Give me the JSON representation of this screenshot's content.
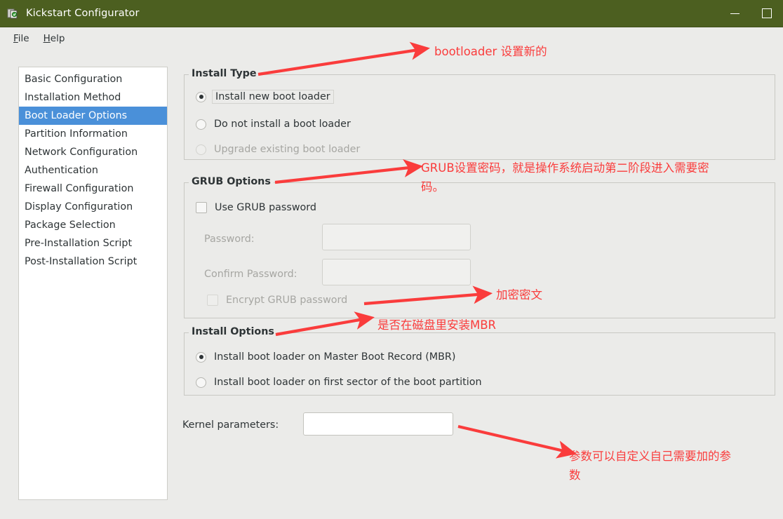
{
  "window": {
    "title": "Kickstart Configurator",
    "icon": "app-icon",
    "minimize_label": "Minimize",
    "maximize_label": "Maximize"
  },
  "menubar": {
    "items": [
      {
        "label": "File",
        "mnemonic": "F"
      },
      {
        "label": "Help",
        "mnemonic": "H"
      }
    ]
  },
  "sidebar": {
    "items": [
      {
        "label": "Basic Configuration",
        "selected": false
      },
      {
        "label": "Installation Method",
        "selected": false
      },
      {
        "label": "Boot Loader Options",
        "selected": true
      },
      {
        "label": "Partition Information",
        "selected": false
      },
      {
        "label": "Network Configuration",
        "selected": false
      },
      {
        "label": "Authentication",
        "selected": false
      },
      {
        "label": "Firewall Configuration",
        "selected": false
      },
      {
        "label": "Display Configuration",
        "selected": false
      },
      {
        "label": "Package Selection",
        "selected": false
      },
      {
        "label": "Pre-Installation Script",
        "selected": false
      },
      {
        "label": "Post-Installation Script",
        "selected": false
      }
    ]
  },
  "install_type": {
    "legend": "Install Type",
    "options": [
      {
        "label": "Install new boot loader",
        "checked": true,
        "disabled": false,
        "focused": true
      },
      {
        "label": "Do not install a boot loader",
        "checked": false,
        "disabled": false,
        "focused": false
      },
      {
        "label": "Upgrade existing boot loader",
        "checked": false,
        "disabled": true,
        "focused": false
      }
    ]
  },
  "grub_options": {
    "legend": "GRUB Options",
    "use_grub_password": {
      "label": "Use GRUB password",
      "checked": false,
      "disabled": false
    },
    "password": {
      "label": "Password:",
      "value": "",
      "disabled": true
    },
    "confirm_password": {
      "label": "Confirm Password:",
      "value": "",
      "disabled": true
    },
    "encrypt": {
      "label": "Encrypt GRUB password",
      "checked": false,
      "disabled": true
    }
  },
  "install_options": {
    "legend": "Install Options",
    "options": [
      {
        "label": "Install boot loader on Master Boot Record (MBR)",
        "checked": true
      },
      {
        "label": "Install boot loader on first sector of the boot partition",
        "checked": false
      }
    ]
  },
  "kernel_parameters": {
    "label": "Kernel parameters:",
    "value": "",
    "placeholder": ""
  },
  "annotations": {
    "color": "#fa3c3c",
    "notes": [
      {
        "id": "note-bootloader",
        "text": "bootloader 设置新的"
      },
      {
        "id": "note-grub-password",
        "text": "GRUB设置密码，就是操作系统启动第二阶段进入需要密\n码。"
      },
      {
        "id": "note-encrypt",
        "text": "加密密文"
      },
      {
        "id": "note-mbr",
        "text": "是否在磁盘里安装MBR"
      },
      {
        "id": "note-kernel-params",
        "text": "参数可以自定义自己需要加的参\n数"
      }
    ]
  }
}
